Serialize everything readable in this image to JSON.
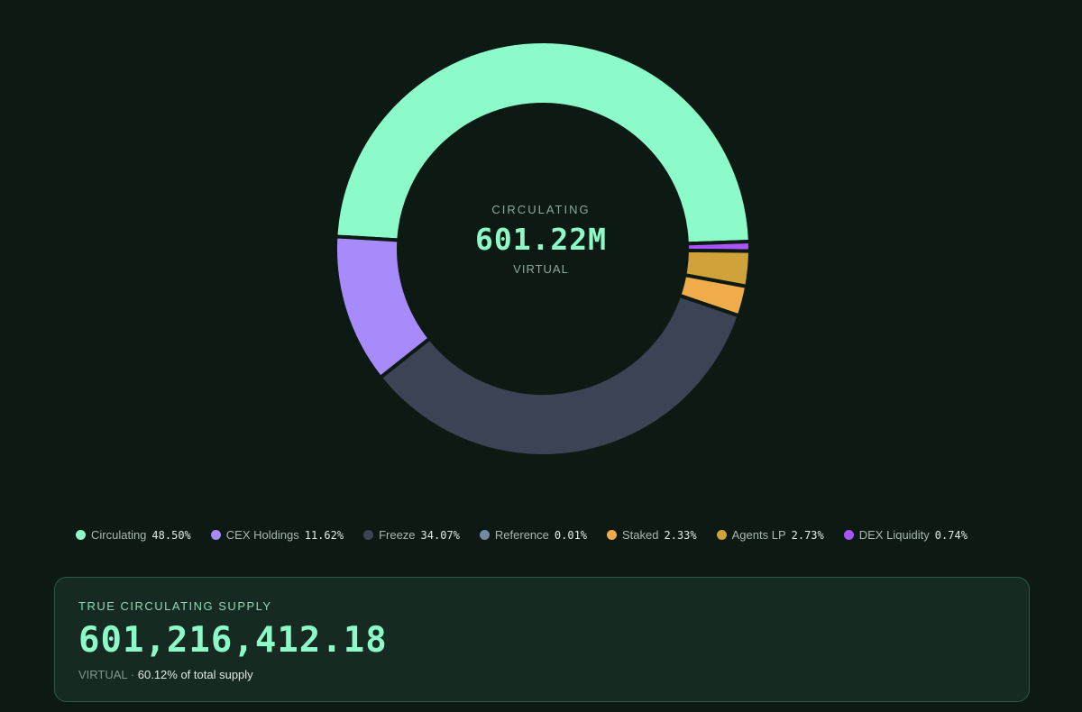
{
  "chart_data": {
    "type": "pie",
    "style": "donut",
    "center": {
      "caption": "CIRCULATING",
      "value": "601.22M",
      "unit": "VIRTUAL"
    },
    "slices": [
      {
        "name": "Circulating",
        "value": 48.5,
        "label": "48.50%",
        "color": "#8dfbc9"
      },
      {
        "name": "DEX Liquidity",
        "value": 0.74,
        "label": "0.74%",
        "color": "#a855f7"
      },
      {
        "name": "Agents LP",
        "value": 2.73,
        "label": "2.73%",
        "color": "#cfa33a"
      },
      {
        "name": "Staked",
        "value": 2.33,
        "label": "2.33%",
        "color": "#f0ac4a"
      },
      {
        "name": "Reference",
        "value": 0.01,
        "label": "0.01%",
        "color": "#7488a3"
      },
      {
        "name": "Freeze",
        "value": 34.07,
        "label": "34.07%",
        "color": "#3c4354"
      },
      {
        "name": "CEX Holdings",
        "value": 11.62,
        "label": "11.62%",
        "color": "#a78bfa"
      }
    ],
    "legend_order": [
      "Circulating",
      "CEX Holdings",
      "Freeze",
      "Reference",
      "Staked",
      "Agents LP",
      "DEX Liquidity"
    ],
    "legend_placement": "bottom"
  },
  "supply_card": {
    "title": "TRUE CIRCULATING SUPPLY",
    "value": "601,216,412.18",
    "unit": "VIRTUAL",
    "separator": " · ",
    "pct_text": "60.12% of total supply"
  },
  "colors": {
    "background": "#0d1a14",
    "accent": "#8dfbc9",
    "card_bg": "#162a21",
    "card_border": "#2e5a45"
  }
}
